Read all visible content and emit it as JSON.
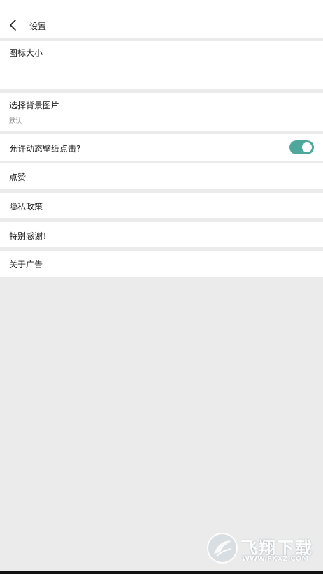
{
  "header": {
    "title": "设置"
  },
  "settings": {
    "icon_size": {
      "label": "图标大小"
    },
    "background": {
      "label": "选择背景图片",
      "value": "默认"
    },
    "allow_click": {
      "label": "允许动态壁纸点击?",
      "enabled": true
    },
    "like": {
      "label": "点赞"
    },
    "privacy": {
      "label": "隐私政策"
    },
    "thanks": {
      "label": "特别感谢！"
    },
    "about_ads": {
      "label": "关于广告"
    }
  },
  "watermark": {
    "main": "飞翔下载",
    "sub": "WWW.FXXZ.COM"
  },
  "colors": {
    "toggle_on": "#4ea79b",
    "background": "#ebebeb",
    "surface": "#ffffff"
  }
}
